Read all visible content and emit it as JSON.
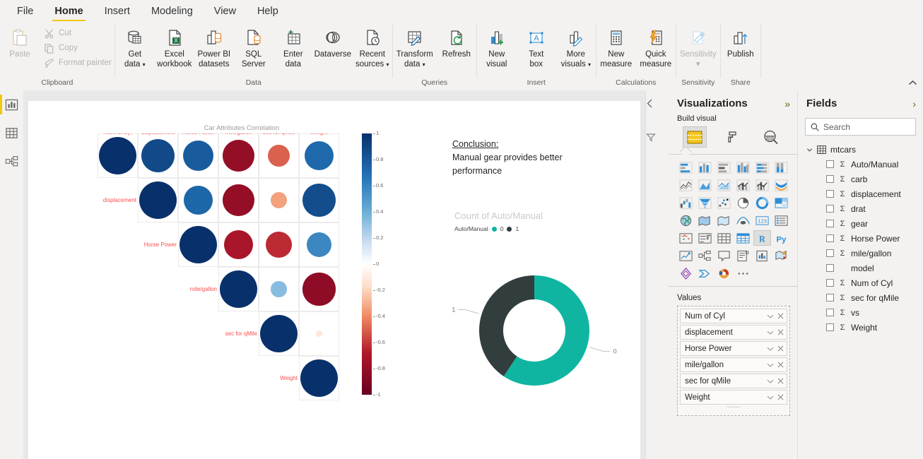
{
  "app": {
    "ribbon_collapse_icon": "chevron-up-icon",
    "tabs": [
      {
        "label": "File",
        "active": false
      },
      {
        "label": "Home",
        "active": true
      },
      {
        "label": "Insert",
        "active": false
      },
      {
        "label": "Modeling",
        "active": false
      },
      {
        "label": "View",
        "active": false
      },
      {
        "label": "Help",
        "active": false
      }
    ]
  },
  "ribbon": {
    "clipboard": {
      "group_label": "Clipboard",
      "paste_label": "Paste",
      "items": [
        {
          "label": "Cut",
          "icon": "scissors-icon"
        },
        {
          "label": "Copy",
          "icon": "copy-icon"
        },
        {
          "label": "Format painter",
          "icon": "paintbrush-icon"
        }
      ]
    },
    "data": {
      "group_label": "Data",
      "buttons": [
        {
          "line1": "Get",
          "line2": "data",
          "icon": "database-icon",
          "caret": true
        },
        {
          "line1": "Excel",
          "line2": "workbook",
          "icon": "excel-icon",
          "caret": false
        },
        {
          "line1": "Power BI",
          "line2": "datasets",
          "icon": "powerbi-datasets-icon",
          "caret": false
        },
        {
          "line1": "SQL",
          "line2": "Server",
          "icon": "sql-server-icon",
          "caret": false
        },
        {
          "line1": "Enter",
          "line2": "data",
          "icon": "enter-data-icon",
          "caret": false
        },
        {
          "line1": "Dataverse",
          "line2": "",
          "icon": "dataverse-icon",
          "caret": false
        },
        {
          "line1": "Recent",
          "line2": "sources",
          "icon": "recent-sources-icon",
          "caret": true
        }
      ]
    },
    "queries": {
      "group_label": "Queries",
      "buttons": [
        {
          "line1": "Transform",
          "line2": "data",
          "icon": "transform-data-icon",
          "caret": true
        },
        {
          "line1": "Refresh",
          "line2": "",
          "icon": "refresh-icon",
          "caret": false
        }
      ]
    },
    "insert": {
      "group_label": "Insert",
      "buttons": [
        {
          "line1": "New",
          "line2": "visual",
          "icon": "new-visual-icon",
          "caret": false
        },
        {
          "line1": "Text",
          "line2": "box",
          "icon": "text-box-icon",
          "caret": false
        },
        {
          "line1": "More",
          "line2": "visuals",
          "icon": "more-visuals-icon",
          "caret": true
        }
      ]
    },
    "calculations": {
      "group_label": "Calculations",
      "buttons": [
        {
          "line1": "New",
          "line2": "measure",
          "icon": "new-measure-icon",
          "caret": false
        },
        {
          "line1": "Quick",
          "line2": "measure",
          "icon": "quick-measure-icon",
          "caret": false
        }
      ]
    },
    "sensitivity": {
      "group_label": "Sensitivity",
      "buttons": [
        {
          "line1": "Sensitivity",
          "line2": "",
          "icon": "sensitivity-icon",
          "caret": true,
          "disabled": true
        }
      ]
    },
    "share": {
      "group_label": "Share",
      "buttons": [
        {
          "line1": "Publish",
          "line2": "",
          "icon": "publish-icon",
          "caret": false
        }
      ]
    }
  },
  "rail": {
    "items": [
      {
        "name": "report-view",
        "icon": "report-bars-icon",
        "active": true
      },
      {
        "name": "data-view",
        "icon": "table-grid-icon",
        "active": false
      },
      {
        "name": "model-view",
        "icon": "model-relationships-icon",
        "active": false
      }
    ]
  },
  "filters_pane": {
    "collapse_icon": "chevron-left-icon",
    "filter_icon": "funnel-icon",
    "label": "Filters"
  },
  "visualizations": {
    "title": "Visualizations",
    "expand_icon": "double-chevron-icon",
    "build_label": "Build visual",
    "tabs": [
      {
        "name": "build-visual-tab",
        "icon": "fields-build-icon",
        "selected": true
      },
      {
        "name": "format-visual-tab",
        "icon": "paint-roller-icon",
        "selected": false
      },
      {
        "name": "analytics-tab",
        "icon": "magnifier-chart-icon",
        "selected": false
      }
    ],
    "icons": [
      "stacked-bar-chart-icon",
      "stacked-column-chart-icon",
      "clustered-bar-chart-icon",
      "clustered-column-chart-icon",
      "100-stacked-bar-chart-icon",
      "100-stacked-column-chart-icon",
      "line-chart-icon",
      "area-chart-icon",
      "stacked-area-chart-icon",
      "line-stacked-column-icon",
      "line-clustered-column-icon",
      "ribbon-chart-icon",
      "waterfall-chart-icon",
      "funnel-chart-icon",
      "scatter-chart-icon",
      "pie-chart-icon",
      "donut-chart-icon",
      "treemap-icon",
      "map-icon",
      "filled-map-icon",
      "shape-map-icon",
      "azure-map-icon",
      "card-icon",
      "multi-row-card-icon",
      "kpi-icon",
      "slicer-icon",
      "table-icon",
      "matrix-icon",
      "r-script-visual-icon",
      "python-visual-icon",
      "key-influencers-icon",
      "decomposition-tree-icon",
      "qna-icon",
      "smart-narrative-icon",
      "paginated-report-icon",
      "arcgis-maps-icon",
      "powerapps-icon",
      "power-automate-icon",
      "sunburst-icon",
      "more-options-icon"
    ],
    "selected_icon": "r-script-visual-icon",
    "values_label": "Values",
    "values": [
      {
        "label": "Num of Cyl"
      },
      {
        "label": "displacement"
      },
      {
        "label": "Horse Power"
      },
      {
        "label": "mile/gallon"
      },
      {
        "label": "sec for qMile"
      },
      {
        "label": "Weight"
      }
    ],
    "chip_caret_icon": "chevron-down-icon",
    "chip_remove_icon": "close-x-icon"
  },
  "fields": {
    "title": "Fields",
    "expand_icon": "chevron-right-icon",
    "search_icon": "search-icon",
    "search_placeholder": "Search",
    "search_value": "",
    "table_name": "mtcars",
    "table_icon": "table-icon",
    "table_expand_icon": "chevron-down-icon",
    "items": [
      {
        "label": "Auto/Manual",
        "aggregate": true,
        "checked": false
      },
      {
        "label": "carb",
        "aggregate": true,
        "checked": false
      },
      {
        "label": "displacement",
        "aggregate": true,
        "checked": false
      },
      {
        "label": "drat",
        "aggregate": true,
        "checked": false
      },
      {
        "label": "gear",
        "aggregate": true,
        "checked": false
      },
      {
        "label": "Horse Power",
        "aggregate": true,
        "checked": false
      },
      {
        "label": "mile/gallon",
        "aggregate": true,
        "checked": false
      },
      {
        "label": "model",
        "aggregate": false,
        "checked": false
      },
      {
        "label": "Num of Cyl",
        "aggregate": true,
        "checked": false
      },
      {
        "label": "sec for qMile",
        "aggregate": true,
        "checked": false
      },
      {
        "label": "vs",
        "aggregate": true,
        "checked": false
      },
      {
        "label": "Weight",
        "aggregate": true,
        "checked": false
      }
    ]
  },
  "report": {
    "textbox": {
      "heading": "Conclusion:",
      "line1": "Manual gear provides better",
      "line2": "performance"
    }
  },
  "chart_data": [
    {
      "type": "heatmap",
      "title": "Car Attributes Correlation",
      "subtype": "correlogram-circles-upper-triangle",
      "categories": [
        "Num of Cyl",
        "displacement",
        "Horse Power",
        "mile/gallon",
        "sec for qMile",
        "Weight"
      ],
      "colorbar": {
        "ticks": [
          1,
          0.8,
          0.6,
          0.4,
          0.2,
          0,
          -0.2,
          -0.4,
          -0.6,
          -0.8,
          -1
        ],
        "tick_labels": [
          "1",
          "0.8",
          "0.6",
          "0.4",
          "0.2",
          "0",
          "-0.2",
          "-0.4",
          "-0.6",
          "-0.8",
          "-1"
        ],
        "high_color": "#08306b",
        "mid_color": "#ffffff",
        "low_color": "#67001f",
        "range": [
          -1,
          1
        ]
      },
      "matrix": [
        [
          1.0,
          0.9,
          0.83,
          -0.85,
          -0.59,
          0.78
        ],
        [
          null,
          1.0,
          0.79,
          -0.85,
          -0.43,
          0.89
        ],
        [
          null,
          null,
          1.0,
          -0.78,
          -0.71,
          0.66
        ],
        [
          null,
          null,
          null,
          1.0,
          0.42,
          -0.87
        ],
        [
          null,
          null,
          null,
          null,
          1.0,
          -0.17
        ],
        [
          null,
          null,
          null,
          null,
          null,
          1.0
        ]
      ],
      "xlabel": "",
      "ylabel": "",
      "label_color": "#ff4d4d"
    },
    {
      "type": "pie",
      "subtype": "donut",
      "title": "Count of Auto/Manual",
      "legend_title": "Auto/Manual",
      "legend_position": "top",
      "categories": [
        "0",
        "1"
      ],
      "values": [
        19,
        13
      ],
      "percentages": [
        59.4,
        40.6
      ],
      "colors": [
        "#0fb5a0",
        "#323d3e"
      ],
      "data_labels": [
        "0",
        "1"
      ]
    }
  ]
}
